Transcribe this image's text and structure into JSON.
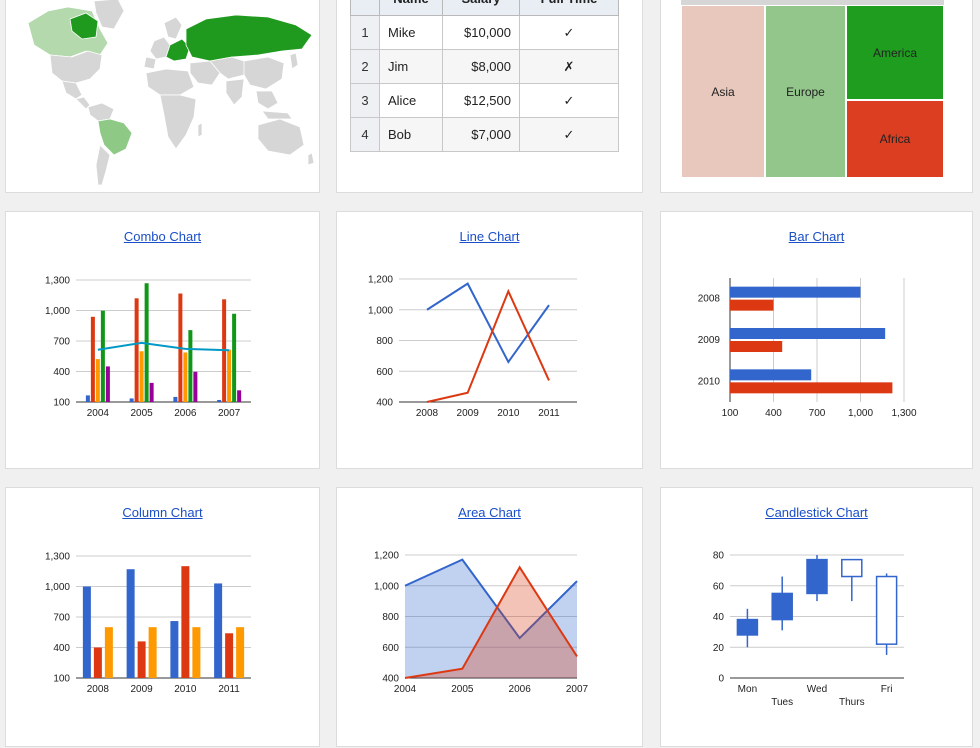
{
  "table": {
    "headers": [
      "Name",
      "Salary",
      "Full Time"
    ],
    "rows": [
      {
        "index": "1",
        "name": "Mike",
        "salary": "$10,000",
        "full_time": "✓"
      },
      {
        "index": "2",
        "name": "Jim",
        "salary": "$8,000",
        "full_time": "✗"
      },
      {
        "index": "3",
        "name": "Alice",
        "salary": "$12,500",
        "full_time": "✓"
      },
      {
        "index": "4",
        "name": "Bob",
        "salary": "$7,000",
        "full_time": "✓"
      }
    ]
  },
  "treemap": {
    "nodes": [
      {
        "label": "Asia",
        "color": "#e8c8bc"
      },
      {
        "label": "Europe",
        "color": "#93c68a"
      },
      {
        "label": "America",
        "color": "#1e9d1e"
      },
      {
        "label": "Africa",
        "color": "#dc3e21"
      }
    ]
  },
  "titles": {
    "combo": "Combo Chart",
    "line": "Line Chart",
    "bar": "Bar Chart",
    "column": "Column Chart",
    "area": "Area Chart",
    "candle": "Candlestick Chart"
  },
  "colors": {
    "blue": "#3366cc",
    "red": "#dc3912",
    "orange": "#ff9900",
    "green": "#109618",
    "purple": "#990099",
    "teal": "#0099c6",
    "map_highlight": "#1f9a1f",
    "map_base": "#d6d6d6"
  },
  "chart_data": [
    {
      "id": "combo",
      "type": "bar",
      "title": "Combo Chart",
      "categories": [
        "2004",
        "2005",
        "2006",
        "2007"
      ],
      "ylim": [
        100,
        1300
      ],
      "yticks": [
        "100",
        "400",
        "700",
        "1,000",
        "1,300"
      ],
      "series": [
        {
          "values": [
            165,
            135,
            150,
            120
          ]
        },
        {
          "values": [
            938,
            1120,
            1167,
            1110
          ]
        },
        {
          "values": [
            522,
            599,
            587,
            615
          ]
        },
        {
          "values": [
            998,
            1268,
            807,
            968
          ]
        },
        {
          "values": [
            450,
            288,
            397,
            215
          ]
        }
      ],
      "line": {
        "values": [
          614,
          682,
          623,
          609
        ]
      }
    },
    {
      "id": "line",
      "type": "line",
      "title": "Line Chart",
      "categories": [
        "2008",
        "2009",
        "2010",
        "2011"
      ],
      "ylim": [
        400,
        1200
      ],
      "yticks": [
        "400",
        "600",
        "800",
        "1,000",
        "1,200"
      ],
      "series": [
        {
          "values": [
            1000,
            1170,
            660,
            1030
          ]
        },
        {
          "values": [
            400,
            460,
            1120,
            540
          ]
        }
      ]
    },
    {
      "id": "bar",
      "type": "bar",
      "title": "Bar Chart",
      "categories": [
        "2008",
        "2009",
        "2010"
      ],
      "xlim": [
        100,
        1300
      ],
      "xticks": [
        "100",
        "400",
        "700",
        "1,000",
        "1,300"
      ],
      "series": [
        {
          "values": [
            1000,
            1170,
            660
          ]
        },
        {
          "values": [
            400,
            460,
            1220
          ]
        }
      ]
    },
    {
      "id": "column",
      "type": "bar",
      "title": "Column Chart",
      "categories": [
        "2008",
        "2009",
        "2010",
        "2011"
      ],
      "ylim": [
        100,
        1300
      ],
      "yticks": [
        "100",
        "400",
        "700",
        "1,000",
        "1,300"
      ],
      "series": [
        {
          "values": [
            1000,
            1170,
            660,
            1030
          ]
        },
        {
          "values": [
            400,
            460,
            1200,
            540
          ]
        },
        {
          "values": [
            600,
            600,
            600,
            600
          ]
        }
      ]
    },
    {
      "id": "area",
      "type": "area",
      "title": "Area Chart",
      "categories": [
        "2004",
        "2005",
        "2006",
        "2007"
      ],
      "ylim": [
        400,
        1200
      ],
      "yticks": [
        "400",
        "600",
        "800",
        "1,000",
        "1,200"
      ],
      "series": [
        {
          "values": [
            1000,
            1170,
            660,
            1030
          ]
        },
        {
          "values": [
            400,
            460,
            1120,
            540
          ]
        }
      ]
    },
    {
      "id": "candle",
      "type": "candlestick",
      "title": "Candlestick Chart",
      "categories": [
        "Mon",
        "Tues",
        "Wed",
        "Thurs",
        "Fri"
      ],
      "ylim": [
        0,
        80
      ],
      "yticks": [
        "0",
        "20",
        "40",
        "60",
        "80"
      ],
      "candles": [
        {
          "low": 20,
          "open": 28,
          "close": 38,
          "high": 45
        },
        {
          "low": 31,
          "open": 38,
          "close": 55,
          "high": 66
        },
        {
          "low": 50,
          "open": 55,
          "close": 77,
          "high": 80
        },
        {
          "low": 50,
          "open": 77,
          "close": 66,
          "high": 77
        },
        {
          "low": 15,
          "open": 66,
          "close": 22,
          "high": 68
        }
      ]
    }
  ]
}
